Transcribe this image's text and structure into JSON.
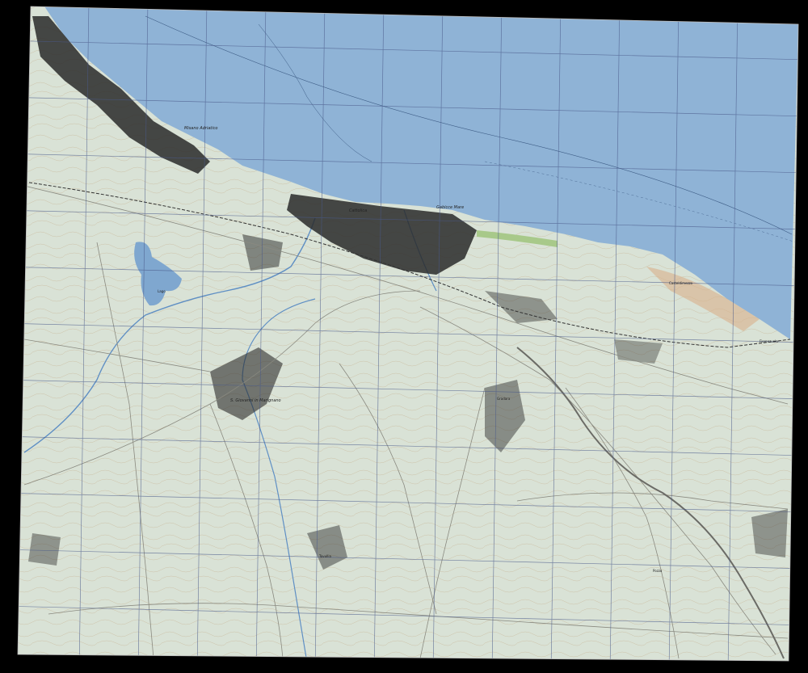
{
  "map": {
    "colors": {
      "sea": "#8fb3d6",
      "land": "#d9e2d6",
      "urban": "#2a2a2a",
      "road": "#8a8a80",
      "contour": "#c9b79a",
      "water": "#7fa7cf",
      "grid": "#4a5a8a",
      "green": "#a8c98a",
      "background": "#000000"
    },
    "labels": {
      "city_main": "Cattolica",
      "city_port": "Gabicce Mare",
      "town_west": "Misano Adriatico",
      "town_inland": "S. Giovanni in Marignano",
      "lake": "Lago",
      "headland": "Casteldimezzo",
      "town_east": "Fiorenzuola",
      "village_south": "Tavullia",
      "village_mid": "Gradara",
      "village_southeast": "Pozzo"
    },
    "features": [
      "coastline",
      "urban-areas",
      "road-network",
      "railway",
      "rivers",
      "contour-lines",
      "utm-grid",
      "sea"
    ]
  }
}
